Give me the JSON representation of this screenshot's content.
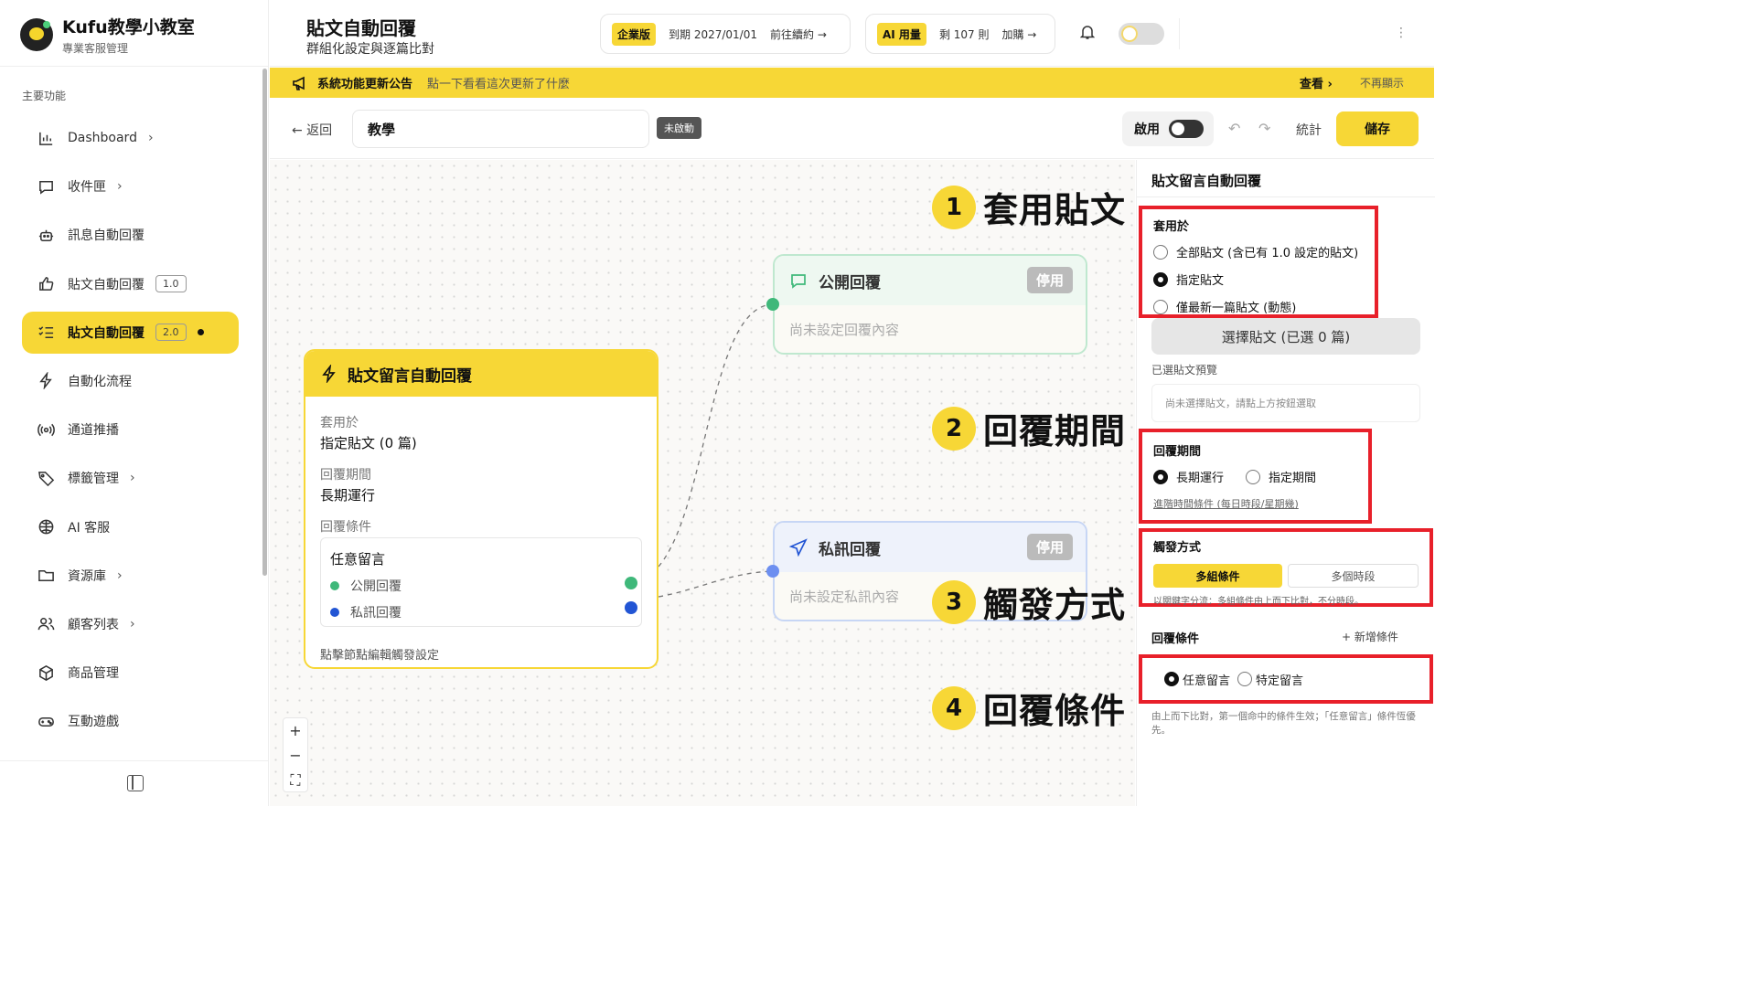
{
  "brand": {
    "title": "Kufu教學小教室",
    "subtitle": "專業客服管理"
  },
  "sidebar": {
    "section_label": "主要功能",
    "items": [
      {
        "label": "Dashboard",
        "icon": "bar-chart-icon",
        "chevron": "›"
      },
      {
        "label": "收件匣",
        "icon": "chat-bubble-icon",
        "chevron": "›"
      },
      {
        "label": "訊息自動回覆",
        "icon": "robot-icon"
      },
      {
        "label": "貼文自動回覆",
        "icon": "thumbs-up-icon",
        "version": "1.0"
      },
      {
        "label": "貼文自動回覆",
        "icon": "list-check-icon",
        "version": "2.0",
        "active": true
      },
      {
        "label": "自動化流程",
        "icon": "lightning-icon"
      },
      {
        "label": "通道推播",
        "icon": "broadcast-icon"
      },
      {
        "label": "標籤管理",
        "icon": "tag-icon",
        "chevron": "›"
      },
      {
        "label": "AI 客服",
        "icon": "ai-brain-icon"
      },
      {
        "label": "資源庫",
        "icon": "folder-icon",
        "chevron": "›"
      },
      {
        "label": "顧客列表",
        "icon": "users-icon",
        "chevron": "›"
      },
      {
        "label": "商品管理",
        "icon": "box-icon"
      },
      {
        "label": "互動遊戲",
        "icon": "gamepad-icon"
      }
    ]
  },
  "header": {
    "title": "貼文自動回覆",
    "subtitle": "群組化設定與逐篇比對",
    "plan": {
      "badge": "企業版",
      "expiry": "到期 2027/01/01",
      "renew": "前往續約 →"
    },
    "ai": {
      "badge": "AI 用量",
      "remaining": "剩 107 則",
      "buy": "加購 →"
    },
    "kebab": "⋮"
  },
  "announcement": {
    "title": "系統功能更新公告",
    "desc": "點一下看看這次更新了什麼",
    "view": "查看 ›",
    "dismiss": "不再顯示"
  },
  "toolbar": {
    "back": "← 返回",
    "name_value": "教學",
    "status": "未啟動",
    "enable_label": "啟用",
    "undo": "↶",
    "redo": "↷",
    "stats": "統計",
    "save": "儲存"
  },
  "canvas": {
    "main_node": {
      "title": "貼文留言自動回覆",
      "apply_label": "套用於",
      "apply_value": "指定貼文 (0 篇)",
      "period_label": "回覆期間",
      "period_value": "長期運行",
      "cond_label": "回覆條件",
      "cond_title": "任意留言",
      "public": "公開回覆",
      "private": "私訊回覆",
      "footer": "點擊節點編輯觸發設定"
    },
    "public_node": {
      "title": "公開回覆",
      "status": "停用",
      "body": "尚未設定回覆內容"
    },
    "private_node": {
      "title": "私訊回覆",
      "status": "停用",
      "body": "尚未設定私訊內容"
    },
    "zoom": {
      "in": "+",
      "out": "−",
      "fit": "⛶"
    },
    "callouts": [
      {
        "num": "1",
        "text": "套用貼文"
      },
      {
        "num": "2",
        "text": "回覆期間"
      },
      {
        "num": "3",
        "text": "觸發方式"
      },
      {
        "num": "4",
        "text": "回覆條件"
      }
    ]
  },
  "panel": {
    "title": "貼文留言自動回覆",
    "apply_heading": "套用於",
    "apply_options": [
      "全部貼文 (含已有 1.0 設定的貼文)",
      "指定貼文",
      "僅最新一篇貼文 (動態)"
    ],
    "apply_selected": 1,
    "select_button": "選擇貼文 (已選 0 篇)",
    "preview_label": "已選貼文預覽",
    "preview_placeholder": "尚未選擇貼文，請點上方按鈕選取",
    "period_heading": "回覆期間",
    "period_options": [
      "長期運行",
      "指定期間"
    ],
    "period_selected": 0,
    "advanced_link": "進階時間條件 (每日時段/星期幾)",
    "trigger_heading": "觸發方式",
    "trigger_options": [
      "多組條件",
      "多個時段"
    ],
    "trigger_hint": "以關鍵字分流：多組條件由上而下比對，不分時段。",
    "cond_heading": "回覆條件",
    "add_condition": "+ 新增條件",
    "cond_options": [
      "任意留言",
      "特定留言"
    ],
    "cond_selected": 0,
    "footnote": "由上而下比對，第一個命中的條件生效；「任意留言」條件恆優先。"
  },
  "colors": {
    "accent": "#f7d736",
    "public": "#3fb87a",
    "private": "#2255d4",
    "highlight": "#e8202a"
  }
}
